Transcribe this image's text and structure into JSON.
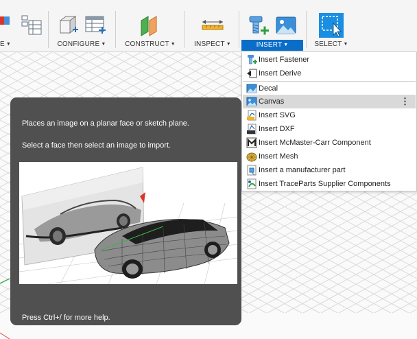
{
  "toolbar": {
    "groups": [
      {
        "label": "E"
      },
      {
        "label": "CONFIGURE"
      },
      {
        "label": "CONSTRUCT"
      },
      {
        "label": "INSPECT"
      },
      {
        "label": "INSERT"
      },
      {
        "label": "SELECT"
      }
    ],
    "active_group": "INSERT",
    "active_color": "#0a6ec8"
  },
  "insert_menu": {
    "items": [
      {
        "label": "Insert Fastener",
        "icon": "fastener-icon"
      },
      {
        "label": "Insert Derive",
        "icon": "derive-icon"
      },
      {
        "label": "Decal",
        "icon": "decal-icon"
      },
      {
        "label": "Canvas",
        "icon": "canvas-icon",
        "highlighted": true,
        "more": "⋮"
      },
      {
        "label": "Insert SVG",
        "icon": "svg-icon"
      },
      {
        "label": "Insert DXF",
        "icon": "dxf-icon"
      },
      {
        "label": "Insert McMaster-Carr Component",
        "icon": "mcmaster-icon"
      },
      {
        "label": "Insert Mesh",
        "icon": "mesh-icon"
      },
      {
        "label": "Insert a manufacturer part",
        "icon": "manufacturer-part-icon"
      },
      {
        "label": "Insert TraceParts Supplier Components",
        "icon": "traceparts-icon"
      }
    ]
  },
  "tooltip": {
    "line1": "Places an image on a planar face or sketch plane.",
    "line2": "Select a face then select an image to import.",
    "help": "Press Ctrl+/ for more help."
  }
}
